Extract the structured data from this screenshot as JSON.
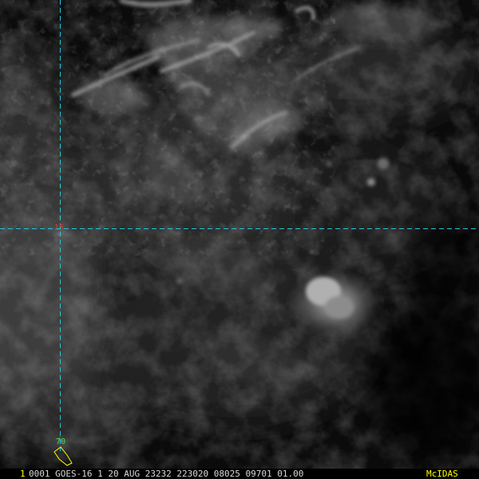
{
  "image": {
    "satellite": "GOES-16",
    "description_colors": {
      "background": "#0a0a0a",
      "cloud_bright": "#9a9a9a",
      "gridline": "#1fc8d8",
      "latitude_label": "#d83a3a",
      "longitude_label": "#4ce04c",
      "status_text": "#d8d8d8",
      "accent_yellow": "#ffff00"
    }
  },
  "gridlines": {
    "latitude_label": "15",
    "longitude_label": "70"
  },
  "status_bar": {
    "frame_number": "1",
    "header": "0001 GOES-16    1 20 AUG 23232 223020 08025 09701 01.00",
    "logo": "McIDAS"
  }
}
